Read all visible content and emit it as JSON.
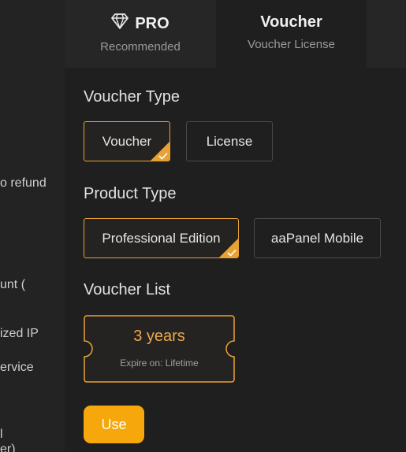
{
  "sidebar_fragments": [
    "o refund",
    "unt (",
    "ized IP",
    "ervice",
    "l",
    "er)"
  ],
  "tabs": [
    {
      "title": "PRO",
      "subtitle": "Recommended",
      "icon": "diamond-icon"
    },
    {
      "title": "Voucher",
      "subtitle": "Voucher License"
    }
  ],
  "voucher_type": {
    "label": "Voucher Type",
    "options": [
      "Voucher",
      "License"
    ],
    "selected": "Voucher"
  },
  "product_type": {
    "label": "Product Type",
    "options": [
      "Professional Edition",
      "aaPanel Mobile"
    ],
    "selected": "Professional Edition"
  },
  "voucher_list": {
    "label": "Voucher List",
    "items": [
      {
        "duration": "3 years",
        "expire": "Expire on: Lifetime"
      }
    ]
  },
  "use_button": "Use",
  "colors": {
    "accent": "#e8a233",
    "button": "#f6a70b",
    "card_text": "#eba94a"
  }
}
